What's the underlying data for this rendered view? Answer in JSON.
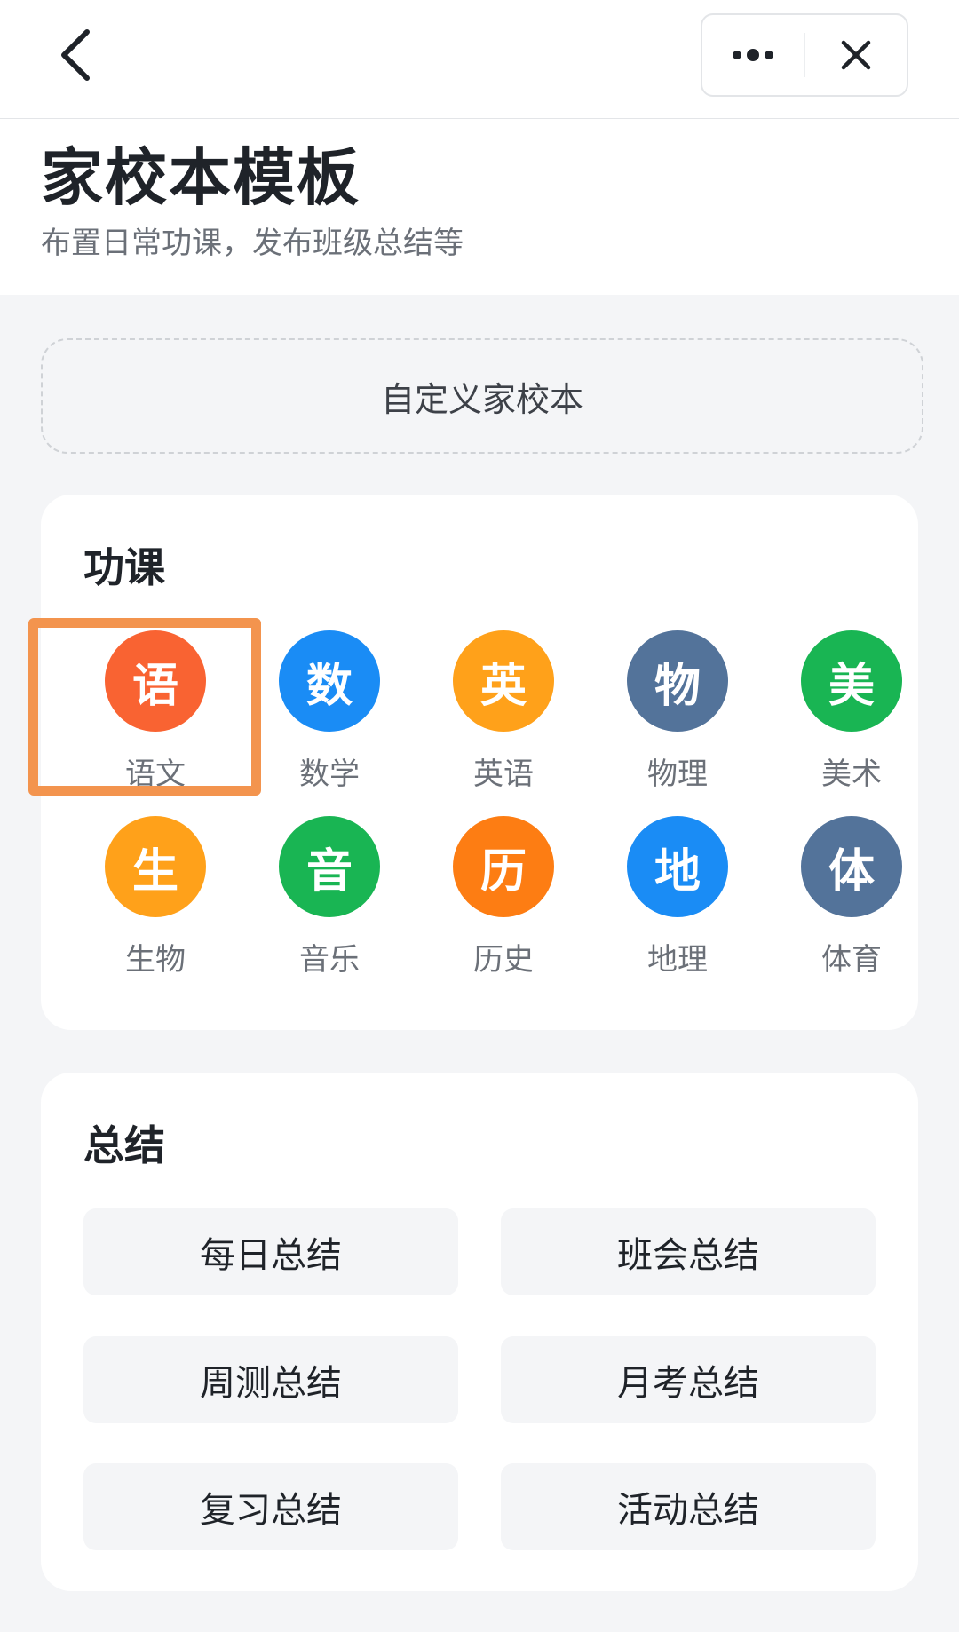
{
  "nav": {
    "back_icon": "chevron-left-icon",
    "more_icon": "more-dots-icon",
    "close_icon": "close-icon"
  },
  "header": {
    "title": "家校本模板",
    "subtitle": "布置日常功课，发布班级总结等"
  },
  "custom_button": {
    "label": "自定义家校本"
  },
  "homework": {
    "title": "功课",
    "subjects": [
      {
        "glyph": "语",
        "label": "语文",
        "color": "#f96332"
      },
      {
        "glyph": "数",
        "label": "数学",
        "color": "#1a8cf5"
      },
      {
        "glyph": "英",
        "label": "英语",
        "color": "#ffa11a"
      },
      {
        "glyph": "物",
        "label": "物理",
        "color": "#53739a"
      },
      {
        "glyph": "美",
        "label": "美术",
        "color": "#19b553"
      },
      {
        "glyph": "生",
        "label": "生物",
        "color": "#ffa11a"
      },
      {
        "glyph": "音",
        "label": "音乐",
        "color": "#19b553"
      },
      {
        "glyph": "历",
        "label": "历史",
        "color": "#fd7d13"
      },
      {
        "glyph": "地",
        "label": "地理",
        "color": "#1a8cf5"
      },
      {
        "glyph": "体",
        "label": "体育",
        "color": "#53739a"
      }
    ]
  },
  "summary": {
    "title": "总结",
    "buttons": [
      {
        "label": "每日总结"
      },
      {
        "label": "班会总结"
      },
      {
        "label": "周测总结"
      },
      {
        "label": "月考总结"
      },
      {
        "label": "复习总结"
      },
      {
        "label": "活动总结"
      }
    ]
  },
  "colors": {
    "highlight": "#f3944e",
    "background": "#f4f5f7"
  }
}
